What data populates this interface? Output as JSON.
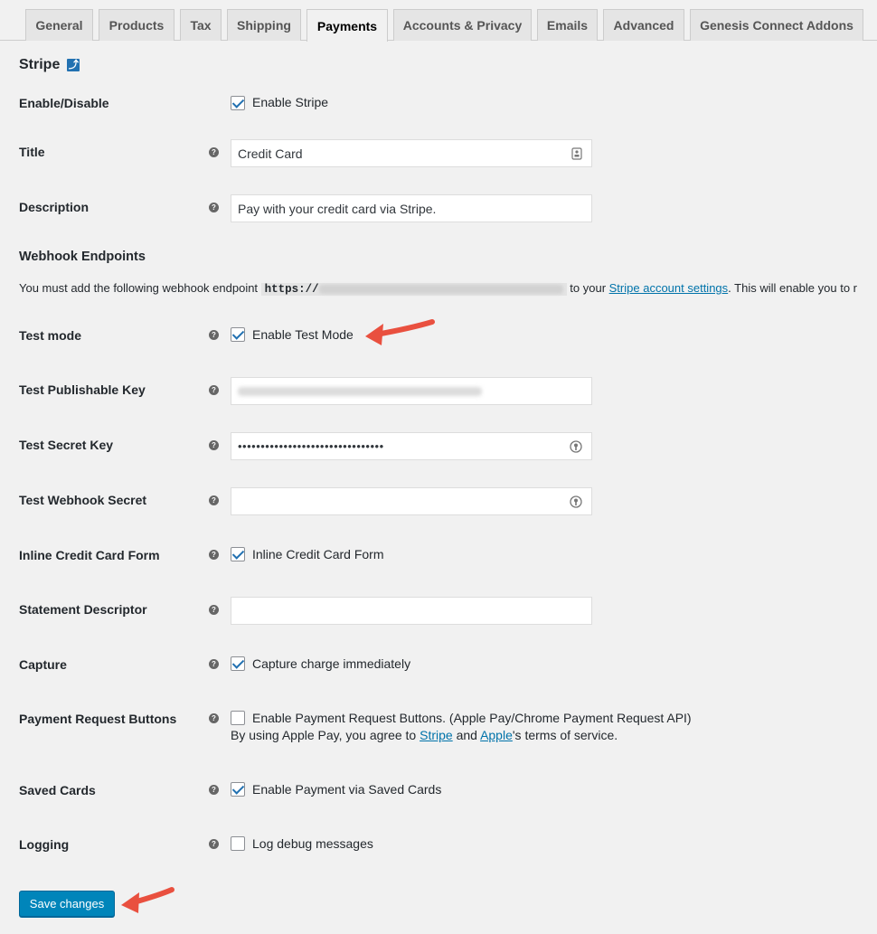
{
  "tabs": [
    "General",
    "Products",
    "Tax",
    "Shipping",
    "Payments",
    "Accounts & Privacy",
    "Emails",
    "Advanced",
    "Genesis Connect Addons"
  ],
  "active_tab": "Payments",
  "section": {
    "title": "Stripe",
    "backlink_glyph": "⤴"
  },
  "fields": {
    "enable": {
      "label": "Enable/Disable",
      "checkbox_label": "Enable Stripe",
      "checked": true
    },
    "title": {
      "label": "Title",
      "value": "Credit Card"
    },
    "description": {
      "label": "Description",
      "value": "Pay with your credit card via Stripe."
    },
    "test_mode": {
      "label": "Test mode",
      "checkbox_label": "Enable Test Mode",
      "checked": true
    },
    "test_publishable_key": {
      "label": "Test Publishable Key"
    },
    "test_secret_key": {
      "label": "Test Secret Key",
      "value": "••••••••••••••••••••••••••••••••"
    },
    "test_webhook_secret": {
      "label": "Test Webhook Secret",
      "value": ""
    },
    "inline_cc": {
      "label": "Inline Credit Card Form",
      "checkbox_label": "Inline Credit Card Form",
      "checked": true
    },
    "statement_descriptor": {
      "label": "Statement Descriptor",
      "value": ""
    },
    "capture": {
      "label": "Capture",
      "checkbox_label": "Capture charge immediately",
      "checked": true
    },
    "payment_request": {
      "label": "Payment Request Buttons",
      "checkbox_label": "Enable Payment Request Buttons. (Apple Pay/Chrome Payment Request API)",
      "checked": false,
      "desc_prefix": "By using Apple Pay, you agree to ",
      "desc_link1": "Stripe",
      "desc_mid": " and ",
      "desc_link2": "Apple",
      "desc_suffix": "'s terms of service."
    },
    "saved_cards": {
      "label": "Saved Cards",
      "checkbox_label": "Enable Payment via Saved Cards",
      "checked": true
    },
    "logging": {
      "label": "Logging",
      "checkbox_label": "Log debug messages",
      "checked": false
    }
  },
  "webhook": {
    "title": "Webhook Endpoints",
    "notice_prefix": "You must add the following webhook endpoint ",
    "endpoint_prefix": "https://",
    "notice_mid": " to your ",
    "settings_link": "Stripe account settings",
    "notice_suffix": ". This will enable you to r"
  },
  "help_glyph": "?",
  "save_label": "Save changes",
  "colors": {
    "primary": "#0085ba",
    "link": "#0073aa",
    "annotation_arrow": "#e9503f"
  }
}
